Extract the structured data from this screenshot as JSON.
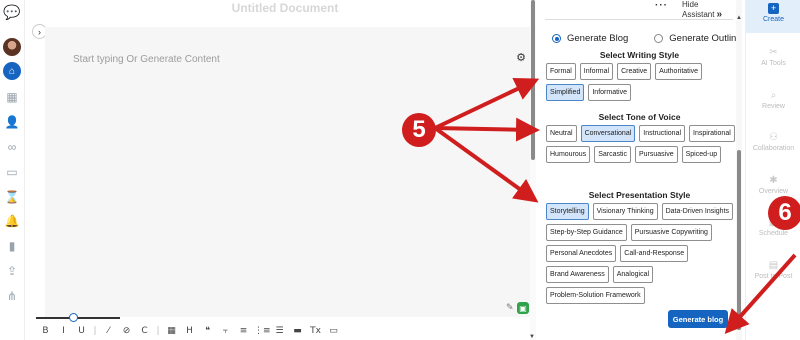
{
  "document": {
    "title": "Untitled Document",
    "placeholder": "Start typing Or Generate Content"
  },
  "toolbar_glyphs": [
    "B",
    "I",
    "U",
    "|",
    "⁄",
    "⊘",
    "C",
    "|",
    "▦",
    "H",
    "❝",
    "⫟",
    "≡",
    "⋮≡",
    "☰",
    "▬",
    "Tx",
    "▭"
  ],
  "assistant": {
    "hide_label": "Hide Assistant",
    "options": [
      {
        "label": "Generate Blog",
        "selected": true
      },
      {
        "label": "Generate Outline",
        "selected": false
      }
    ],
    "writing_style": {
      "title": "Select Writing Style",
      "items": [
        "Formal",
        "Informal",
        "Creative",
        "Authoritative",
        "Simplified",
        "Informative"
      ],
      "selected": "Simplified"
    },
    "tone": {
      "title": "Select Tone of Voice",
      "items": [
        "Neutral",
        "Conversational",
        "Instructional",
        "Inspirational",
        "Humourous",
        "Sarcastic",
        "Pursuasive",
        "Spiced-up"
      ],
      "selected": "Conversational"
    },
    "presentation": {
      "title": "Select Presentation Style",
      "items": [
        "Storytelling",
        "Visionary Thinking",
        "Data-Driven Insights",
        "Step-by-Step Guidance",
        "Pursuasive Copywriting",
        "Personal Anecdotes",
        "Call-and-Response",
        "Brand Awareness",
        "Analogical",
        "Problem-Solution Framework"
      ],
      "selected": "Storytelling"
    },
    "generate_label": "Generate blog"
  },
  "right_nav": [
    {
      "label": "Create",
      "icon": "plus-icon",
      "active": true
    },
    {
      "label": "AI Tools",
      "icon": "ai-tools-icon",
      "active": false
    },
    {
      "label": "Review",
      "icon": "search-icon",
      "active": false
    },
    {
      "label": "Collaboration",
      "icon": "people-icon",
      "active": false
    },
    {
      "label": "Overview",
      "icon": "asterisk-icon",
      "active": false
    },
    {
      "label": "Schedule",
      "icon": "calendar-icon",
      "active": false
    },
    {
      "label": "Post to Post",
      "icon": "post-icon",
      "active": false
    }
  ],
  "annotations": {
    "step_a": "5",
    "step_b": "6",
    "color": "#d01e1e"
  },
  "colors": {
    "accent": "#1565c0",
    "selected_chip": "#d3e5fb"
  }
}
